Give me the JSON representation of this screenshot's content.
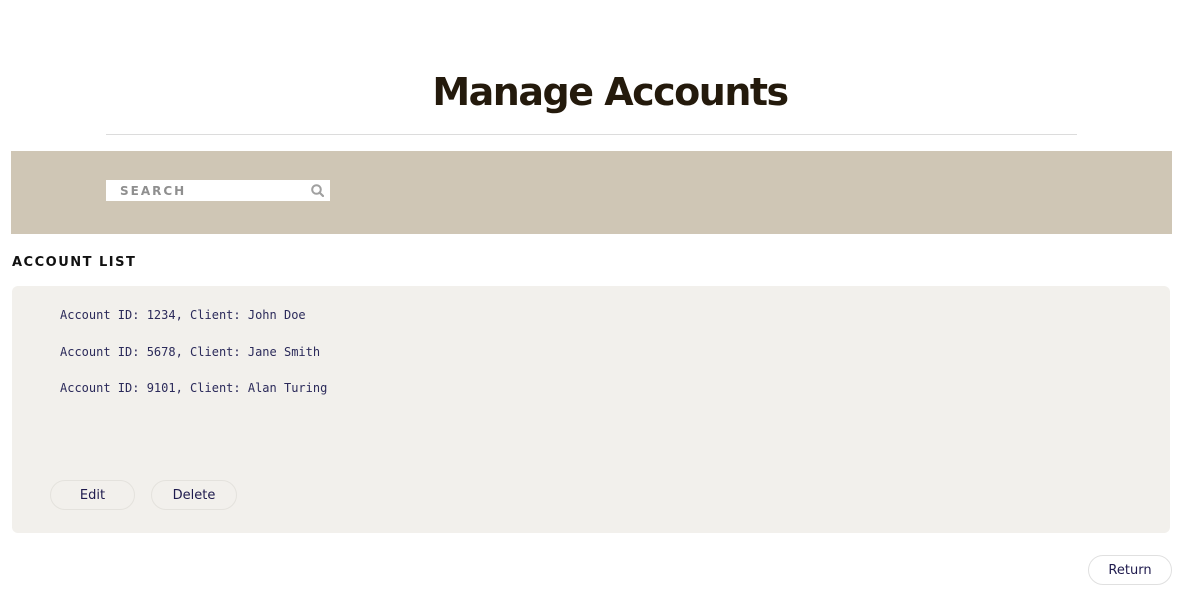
{
  "header": {
    "title": "Manage Accounts"
  },
  "search": {
    "placeholder": "SEARCH",
    "value": "",
    "icon": "search-icon"
  },
  "account_list": {
    "heading": "ACCOUNT LIST",
    "items": [
      "Account ID: 1234, Client: John Doe",
      "Account ID: 5678, Client: Jane Smith",
      "Account ID: 9101, Client: Alan Turing"
    ],
    "actions": {
      "edit_label": "Edit",
      "delete_label": "Delete"
    }
  },
  "footer": {
    "return_label": "Return"
  },
  "colors": {
    "title": "#241a0c",
    "search_band": "#cfc6b5",
    "panel_background": "#f2f0ec",
    "link_text": "#1e1a4d"
  }
}
